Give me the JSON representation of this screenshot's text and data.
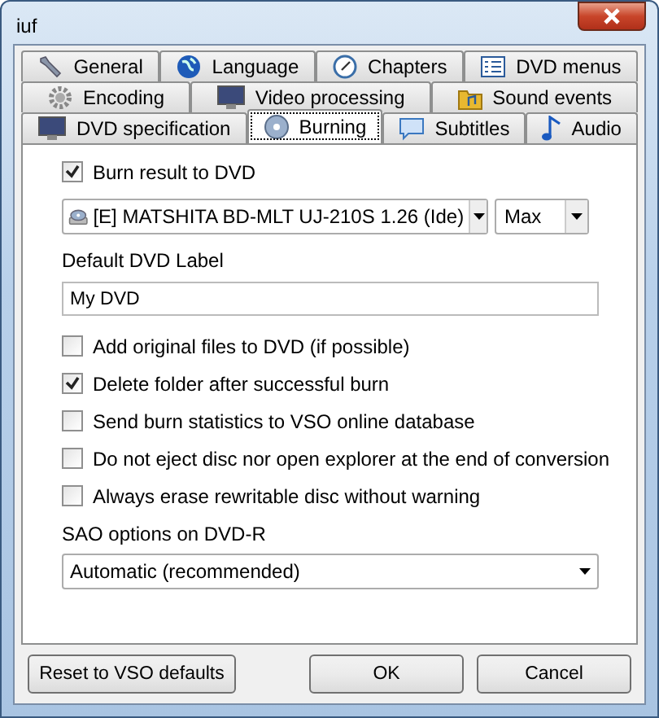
{
  "window": {
    "title": "iuf"
  },
  "tab_rows": [
    [
      {
        "label": "General",
        "selected": false
      },
      {
        "label": "Language",
        "selected": false
      },
      {
        "label": "Chapters",
        "selected": false
      },
      {
        "label": "DVD menus",
        "selected": false
      }
    ],
    [
      {
        "label": "Encoding",
        "selected": false
      },
      {
        "label": "Video processing",
        "selected": false
      },
      {
        "label": "Sound events",
        "selected": false
      }
    ],
    [
      {
        "label": "DVD specification",
        "selected": false
      },
      {
        "label": "Burning",
        "selected": true
      },
      {
        "label": "Subtitles",
        "selected": false
      },
      {
        "label": "Audio",
        "selected": false
      }
    ]
  ],
  "burn": {
    "label": "Burn result to DVD",
    "checked": true
  },
  "drive": {
    "value": "[E] MATSHITA BD-MLT UJ-210S 1.26 (Ide)"
  },
  "speed": {
    "value": "Max"
  },
  "dvd_label": {
    "label": "Default DVD Label",
    "value": "My DVD"
  },
  "options": [
    {
      "label": "Add original files to DVD (if possible)",
      "checked": false
    },
    {
      "label": "Delete folder after successful burn",
      "checked": true
    },
    {
      "label": "Send burn statistics to VSO online database",
      "checked": false
    },
    {
      "label": "Do not eject disc nor open explorer at the end of conversion",
      "checked": false
    },
    {
      "label": "Always erase rewritable disc without warning",
      "checked": false
    }
  ],
  "sao": {
    "label": "SAO options on DVD-R",
    "value": "Automatic (recommended)"
  },
  "buttons": [
    "Reset to VSO defaults",
    "OK",
    "Cancel"
  ]
}
